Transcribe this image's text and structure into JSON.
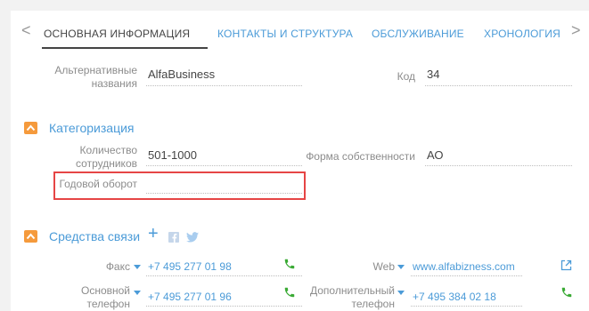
{
  "tabs": {
    "prev_arrow": "<",
    "next_arrow": ">",
    "items": [
      {
        "label": "ОСНОВНАЯ ИНФОРМАЦИЯ"
      },
      {
        "label": "КОНТАКТЫ И СТРУКТУРА"
      },
      {
        "label": "ОБСЛУЖИВАНИЕ"
      },
      {
        "label": "ХРОНОЛОГИЯ"
      }
    ]
  },
  "general": {
    "alt_names_label_1": "Альтернативные",
    "alt_names_label_2": "названия",
    "alt_names_value": "AlfaBusiness",
    "code_label": "Код",
    "code_value": "34"
  },
  "categorization": {
    "title": "Категоризация",
    "employees_label_1": "Количество",
    "employees_label_2": "сотрудников",
    "employees_value": "501-1000",
    "ownership_label": "Форма собственности",
    "ownership_value": "АО",
    "turnover_label": "Годовой оборот",
    "turnover_value": ""
  },
  "communication": {
    "title": "Средства связи",
    "add_symbol": "+",
    "fax_label": "Факс",
    "fax_value": "+7 495 277 01 98",
    "web_label": "Web",
    "web_value": "www.alfabizness.com",
    "main_phone_label_1": "Основной",
    "main_phone_label_2": "телефон",
    "main_phone_value": "+7 495 277 01 96",
    "extra_phone_label_1": "Дополнительный",
    "extra_phone_label_2": "телефон",
    "extra_phone_value": "+7 495 384 02 18"
  },
  "colors": {
    "accent": "#4b9bd8",
    "toggle": "#f59a3c",
    "highlight": "#e64545",
    "phone": "#3aaa35"
  }
}
